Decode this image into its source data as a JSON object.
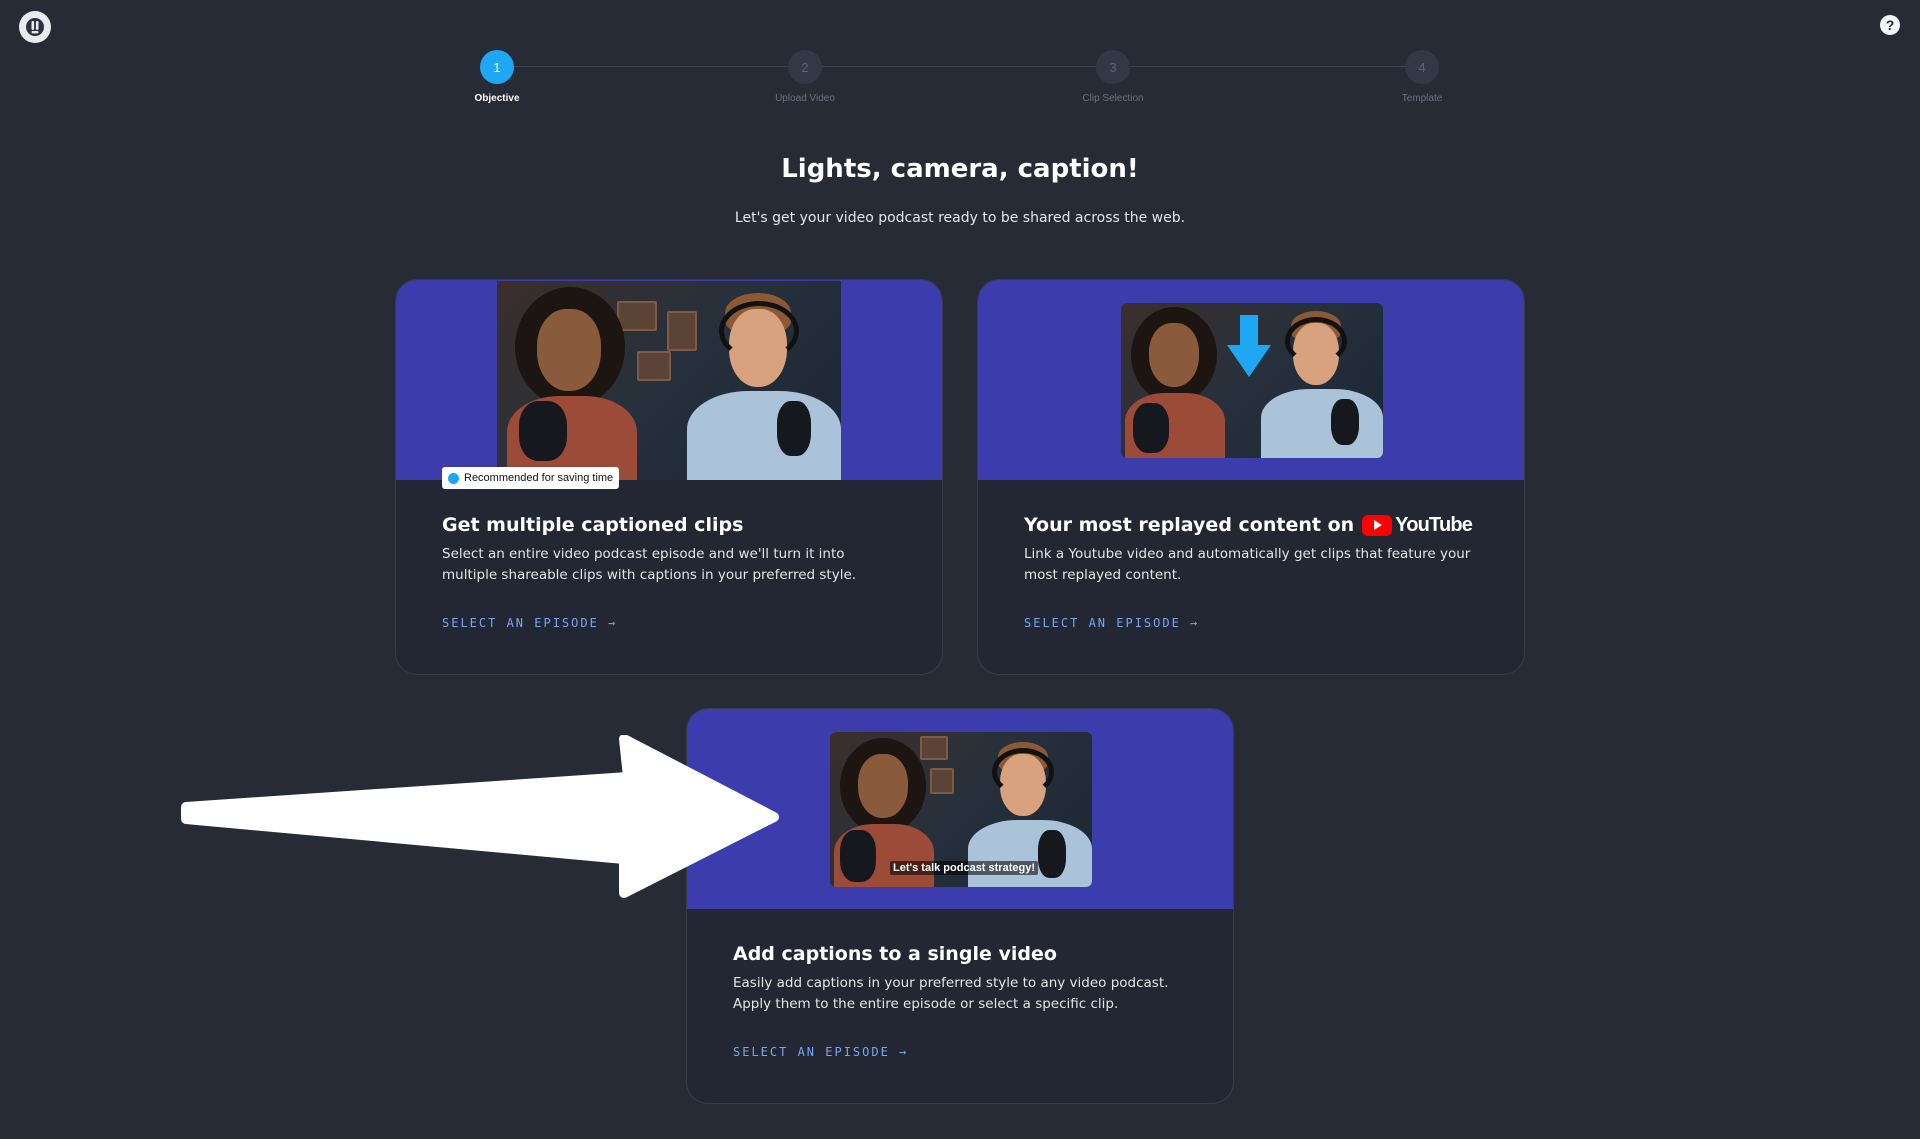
{
  "header": {
    "logo_icon": "app-logo-icon",
    "help_label": "?"
  },
  "stepper": {
    "steps": [
      {
        "number": "1",
        "label": "Objective",
        "active": true
      },
      {
        "number": "2",
        "label": "Upload Video",
        "active": false
      },
      {
        "number": "3",
        "label": "Clip Selection",
        "active": false
      },
      {
        "number": "4",
        "label": "Template",
        "active": false
      }
    ]
  },
  "main": {
    "title": "Lights, camera, caption!",
    "subtitle": "Let's get your video podcast ready to be shared across the web."
  },
  "cards": [
    {
      "badge": "Recommended for saving time",
      "title": "Get multiple captioned clips",
      "description": "Select an entire video podcast episode and we'll turn it into multiple shareable clips with captions in your preferred style.",
      "link": "SELECT AN EPISODE →"
    },
    {
      "title": "Your most replayed content on",
      "brand": "YouTube",
      "description": "Link a Youtube video and automatically get clips that feature your most replayed content.",
      "link": "SELECT AN EPISODE →"
    },
    {
      "title": "Add captions to a single video",
      "caption_preview": "Let's talk podcast strategy!",
      "description": "Easily add captions in your preferred style to any video podcast. Apply them to the entire episode or select a specific clip.",
      "link": "SELECT AN EPISODE →"
    }
  ],
  "colors": {
    "background": "#262b36",
    "card": "#222733",
    "banner": "#3c3cac",
    "accent": "#1ea7f2",
    "link": "#77a6f0",
    "youtube_red": "#ff0000"
  }
}
